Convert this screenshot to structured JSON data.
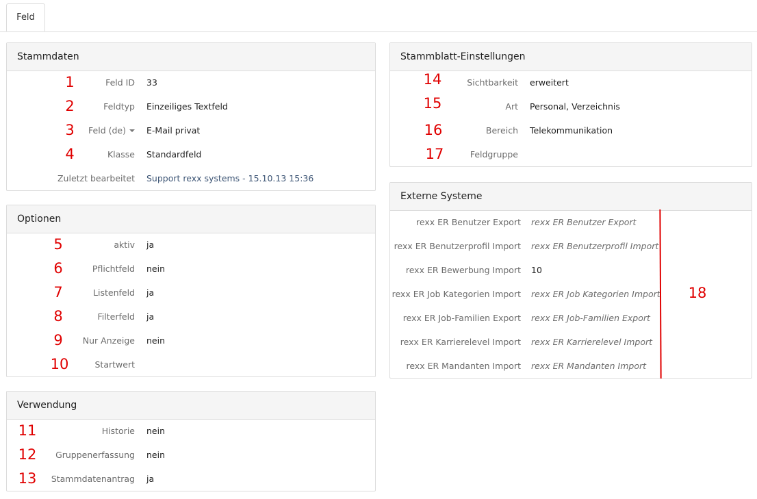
{
  "tabs": [
    {
      "label": "Feld"
    }
  ],
  "stammdaten": {
    "title": "Stammdaten",
    "rows": [
      {
        "num": "1",
        "label": "Feld ID",
        "value": "33"
      },
      {
        "num": "2",
        "label": "Feldtyp",
        "value": "Einzeiliges Textfeld"
      },
      {
        "num": "3",
        "label": "Feld (de)",
        "value": "E-Mail privat"
      },
      {
        "num": "4",
        "label": "Klasse",
        "value": "Standardfeld"
      },
      {
        "num": "",
        "label": "Zuletzt bearbeitet",
        "value": "Support rexx systems - 15.10.13 15:36"
      }
    ]
  },
  "optionen": {
    "title": "Optionen",
    "rows": [
      {
        "num": "5",
        "label": "aktiv",
        "value": "ja"
      },
      {
        "num": "6",
        "label": "Pflichtfeld",
        "value": "nein"
      },
      {
        "num": "7",
        "label": "Listenfeld",
        "value": "ja"
      },
      {
        "num": "8",
        "label": "Filterfeld",
        "value": "ja"
      },
      {
        "num": "9",
        "label": "Nur Anzeige",
        "value": "nein"
      },
      {
        "num": "10",
        "label": "Startwert",
        "value": ""
      }
    ]
  },
  "verwendung": {
    "title": "Verwendung",
    "rows": [
      {
        "num": "11",
        "label": "Historie",
        "value": "nein"
      },
      {
        "num": "12",
        "label": "Gruppenerfassung",
        "value": "nein"
      },
      {
        "num": "13",
        "label": "Stammdatenantrag",
        "value": "ja"
      }
    ]
  },
  "stammblatt": {
    "title": "Stammblatt-Einstellungen",
    "rows": [
      {
        "num": "14",
        "label": "Sichtbarkeit",
        "value": "erweitert"
      },
      {
        "num": "15",
        "label": "Art",
        "value": "Personal, Verzeichnis"
      },
      {
        "num": "16",
        "label": "Bereich",
        "value": "Telekommunikation"
      },
      {
        "num": "17",
        "label": "Feldgruppe",
        "value": ""
      }
    ]
  },
  "externe": {
    "title": "Externe Systeme",
    "annotation": "18",
    "rows": [
      {
        "label": "rexx ER Benutzer Export",
        "value": "rexx ER Benutzer Export",
        "style": "italic"
      },
      {
        "label": "rexx ER Benutzerprofil Import",
        "value": "rexx ER Benutzerprofil Import",
        "style": "italic"
      },
      {
        "label": "rexx ER Bewerbung Import",
        "value": "10",
        "style": "normal"
      },
      {
        "label": "rexx ER Job Kategorien Import",
        "value": "rexx ER Job Kategorien Import",
        "style": "italic"
      },
      {
        "label": "rexx ER Job-Familien Export",
        "value": "rexx ER Job-Familien Export",
        "style": "italic"
      },
      {
        "label": "rexx ER Karrierelevel Import",
        "value": "rexx ER Karrierelevel Import",
        "style": "italic"
      },
      {
        "label": "rexx ER Mandanten Import",
        "value": "rexx ER Mandanten Import",
        "style": "italic"
      }
    ]
  },
  "colors": {
    "annotation": "#e00000",
    "link": "#3d5575"
  }
}
